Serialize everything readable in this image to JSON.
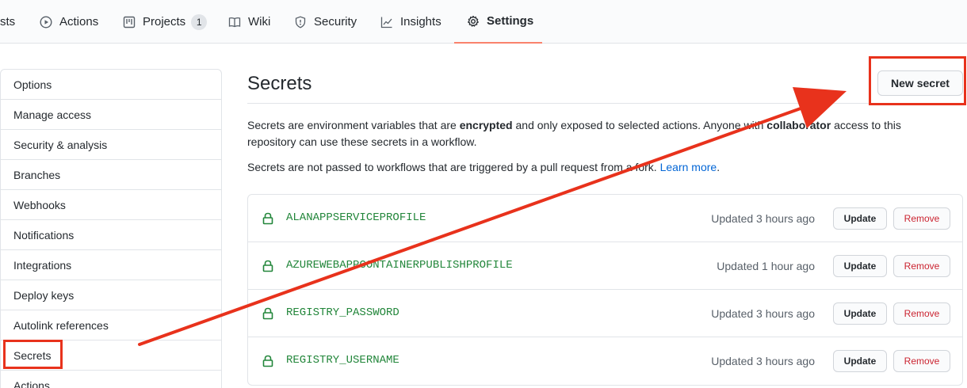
{
  "tabs": [
    {
      "label": "sts",
      "icon": "none"
    },
    {
      "label": "Actions",
      "icon": "play-icon"
    },
    {
      "label": "Projects",
      "icon": "project-icon",
      "count": "1"
    },
    {
      "label": "Wiki",
      "icon": "book-icon"
    },
    {
      "label": "Security",
      "icon": "shield-icon"
    },
    {
      "label": "Insights",
      "icon": "graph-icon"
    },
    {
      "label": "Settings",
      "icon": "gear-icon",
      "selected": true
    }
  ],
  "sidebar": {
    "items": [
      {
        "label": "Options"
      },
      {
        "label": "Manage access"
      },
      {
        "label": "Security & analysis"
      },
      {
        "label": "Branches"
      },
      {
        "label": "Webhooks"
      },
      {
        "label": "Notifications"
      },
      {
        "label": "Integrations"
      },
      {
        "label": "Deploy keys"
      },
      {
        "label": "Autolink references"
      },
      {
        "label": "Secrets",
        "selected": true
      },
      {
        "label": "Actions"
      }
    ]
  },
  "main": {
    "title": "Secrets",
    "new_secret_label": "New secret",
    "desc1": {
      "part1": "Secrets are environment variables that are ",
      "bold1": "encrypted",
      "part2": " and only exposed to selected actions. Anyone with ",
      "bold2": "collaborator",
      "part3": " access to this repository can use these secrets in a workflow."
    },
    "desc2": {
      "text": "Secrets are not passed to workflows that are triggered by a pull request from a fork. ",
      "link": "Learn more",
      "end": "."
    },
    "secrets": [
      {
        "name": "ALANAPPSERVICEPROFILE",
        "updated": "Updated 3 hours ago"
      },
      {
        "name": "AZUREWEBAPPCONTAINERPUBLISHPROFILE",
        "updated": "Updated 1 hour ago"
      },
      {
        "name": "REGISTRY_PASSWORD",
        "updated": "Updated 3 hours ago"
      },
      {
        "name": "REGISTRY_USERNAME",
        "updated": "Updated 3 hours ago"
      }
    ],
    "update_label": "Update",
    "remove_label": "Remove"
  },
  "colors": {
    "accent_underline": "#f9826c",
    "secret_name": "#22863a",
    "remove_text": "#cb2431",
    "link": "#0366d6",
    "annotation": "#e8321c"
  }
}
